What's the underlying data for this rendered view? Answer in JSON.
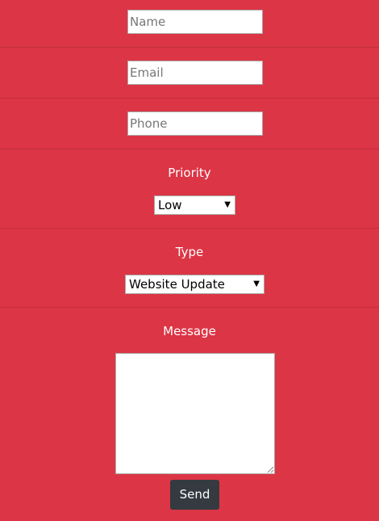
{
  "form": {
    "name_placeholder": "Name",
    "email_placeholder": "Email",
    "phone_placeholder": "Phone",
    "priority_label": "Priority",
    "priority_selected": "Low",
    "type_label": "Type",
    "type_selected": "Website Update",
    "message_label": "Message",
    "message_value": "",
    "send_label": "Send",
    "dropdown_arrow": "▼"
  },
  "colors": {
    "background": "#dc3545",
    "button": "#343a40",
    "divider": "#c22f3e",
    "text": "#ffffff"
  },
  "icons": {
    "dropdown": "chevron-down-icon",
    "resize": "resize-grip-icon"
  }
}
